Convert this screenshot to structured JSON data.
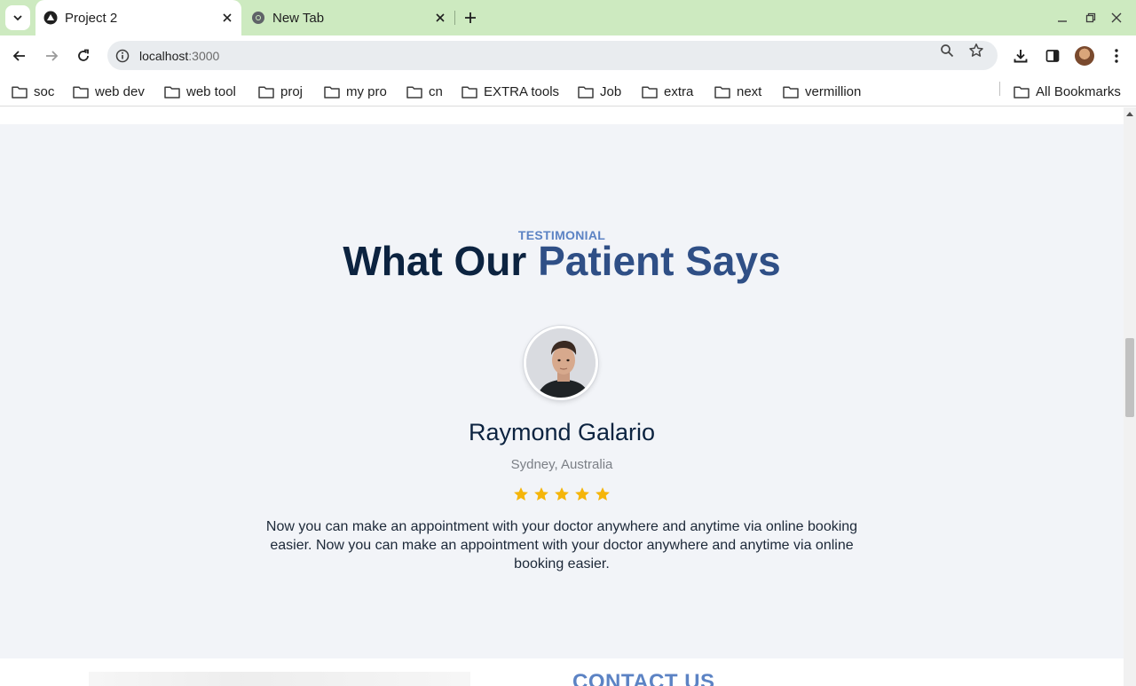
{
  "browser": {
    "tabs": [
      {
        "title": "Project 2",
        "icon": "nextjs-icon",
        "active": true
      },
      {
        "title": "New Tab",
        "icon": "chrome-icon",
        "active": false
      }
    ],
    "url_host": "localhost",
    "url_port": ":3000",
    "bookmarks": [
      "soc",
      "web dev",
      "web tool",
      "proj",
      "my pro",
      "cn",
      "EXTRA tools",
      "Job",
      "extra",
      "next",
      "vermillion"
    ],
    "all_bookmarks_label": "All Bookmarks",
    "theme_color": "#cdeac0"
  },
  "testimonial": {
    "eyebrow": "TESTIMONIAL",
    "heading_main": "What Our ",
    "heading_accent": "Patient Says",
    "name": "Raymond Galario",
    "location": "Sydney, Australia",
    "rating": 5,
    "rating_max": 5,
    "quote": "Now you can make an appointment with your doctor anywhere and anytime via online booking easier. Now you can make an appointment with your doctor anywhere and anytime via online booking easier.",
    "colors": {
      "eyebrow": "#5c83c4",
      "heading": "#0c2340",
      "accent": "#2f4f86",
      "star": "#f5b50a",
      "background": "#f2f4f8"
    }
  },
  "contact": {
    "heading": "CONTACT US"
  }
}
